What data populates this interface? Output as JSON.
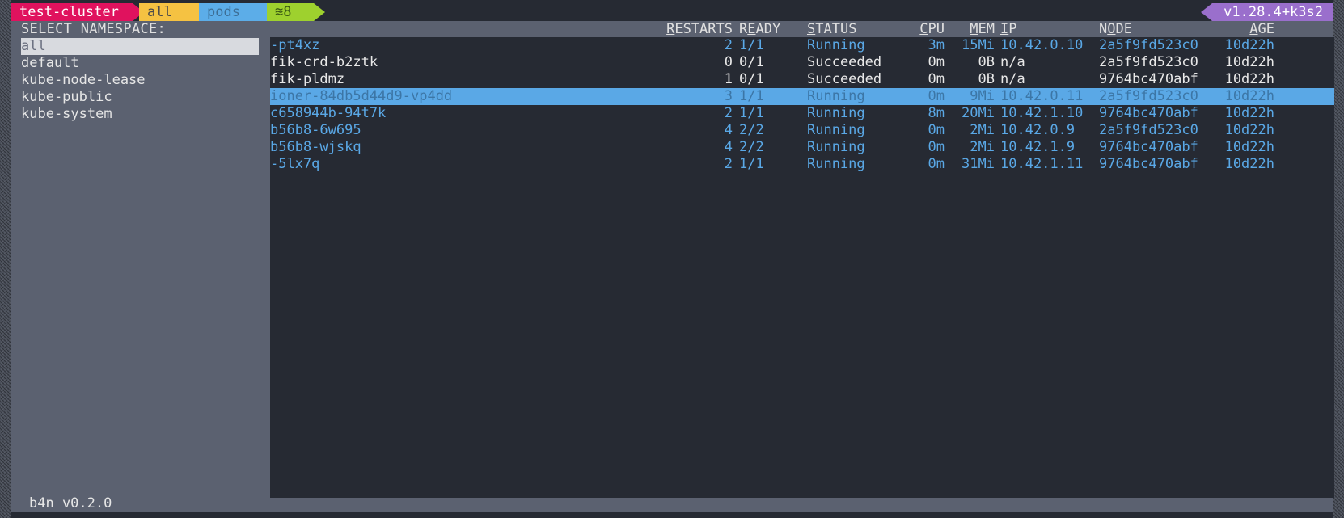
{
  "breadcrumb": {
    "cluster": "test-cluster",
    "namespace": "all",
    "resource": "pods",
    "count": "≋8"
  },
  "version": "v1.28.4+k3s2",
  "namespace_panel": {
    "title": "SELECT NAMESPACE:",
    "items": [
      {
        "label": "all",
        "selected": true
      },
      {
        "label": "default",
        "selected": false
      },
      {
        "label": "kube-node-lease",
        "selected": false
      },
      {
        "label": "kube-public",
        "selected": false
      },
      {
        "label": "kube-system",
        "selected": false
      }
    ]
  },
  "columns": {
    "restarts": {
      "hotkey": "R",
      "rest": "ESTARTS"
    },
    "ready": {
      "pre": "R",
      "hotkey": "E",
      "rest": "ADY"
    },
    "status": {
      "hotkey": "S",
      "rest": "TATUS"
    },
    "cpu": {
      "hotkey": "C",
      "rest": "PU"
    },
    "mem": {
      "hotkey": "M",
      "rest": "EM"
    },
    "ip": {
      "hotkey": "I",
      "rest": "P"
    },
    "node": {
      "pre": "N",
      "hotkey": "O",
      "rest": "DE"
    },
    "age": {
      "hotkey": "A",
      "rest": "GE"
    }
  },
  "pods": [
    {
      "name": "-pt4xz",
      "restarts": "2",
      "ready": "1/1",
      "status": "Running",
      "cpu": "3m",
      "mem": "15Mi",
      "ip": "10.42.0.10",
      "node": "2a5f9fd523c0",
      "age": "10d22h",
      "style": "blue"
    },
    {
      "name": "fik-crd-b2ztk",
      "restarts": "0",
      "ready": "0/1",
      "status": "Succeeded",
      "cpu": "0m",
      "mem": "0B",
      "ip": "n/a",
      "node": "2a5f9fd523c0",
      "age": "10d22h",
      "style": "white"
    },
    {
      "name": "fik-pldmz",
      "restarts": "1",
      "ready": "0/1",
      "status": "Succeeded",
      "cpu": "0m",
      "mem": "0B",
      "ip": "n/a",
      "node": "9764bc470abf",
      "age": "10d22h",
      "style": "white"
    },
    {
      "name": "ioner-84db5d44d9-vp4dd",
      "restarts": "3",
      "ready": "1/1",
      "status": "Running",
      "cpu": "0m",
      "mem": "9Mi",
      "ip": "10.42.0.11",
      "node": "2a5f9fd523c0",
      "age": "10d22h",
      "style": "selected"
    },
    {
      "name": "c658944b-94t7k",
      "restarts": "2",
      "ready": "1/1",
      "status": "Running",
      "cpu": "8m",
      "mem": "20Mi",
      "ip": "10.42.1.10",
      "node": "9764bc470abf",
      "age": "10d22h",
      "style": "blue"
    },
    {
      "name": "b56b8-6w695",
      "restarts": "4",
      "ready": "2/2",
      "status": "Running",
      "cpu": "0m",
      "mem": "2Mi",
      "ip": "10.42.0.9",
      "node": "2a5f9fd523c0",
      "age": "10d22h",
      "style": "blue"
    },
    {
      "name": "b56b8-wjskq",
      "restarts": "4",
      "ready": "2/2",
      "status": "Running",
      "cpu": "0m",
      "mem": "2Mi",
      "ip": "10.42.1.9",
      "node": "9764bc470abf",
      "age": "10d22h",
      "style": "blue"
    },
    {
      "name": "-5lx7q",
      "restarts": "2",
      "ready": "1/1",
      "status": "Running",
      "cpu": "0m",
      "mem": "31Mi",
      "ip": "10.42.1.11",
      "node": "9764bc470abf",
      "age": "10d22h",
      "style": "blue"
    }
  ],
  "footer": "b4n v0.2.0",
  "colors": {
    "cluster": "#e0125e",
    "namespace": "#f5c242",
    "resource": "#5cade8",
    "count": "#9ed12e",
    "version": "#9a6fcc",
    "frame": "#5b6170",
    "panel": "#262a33",
    "running_text": "#5aa8e6"
  }
}
